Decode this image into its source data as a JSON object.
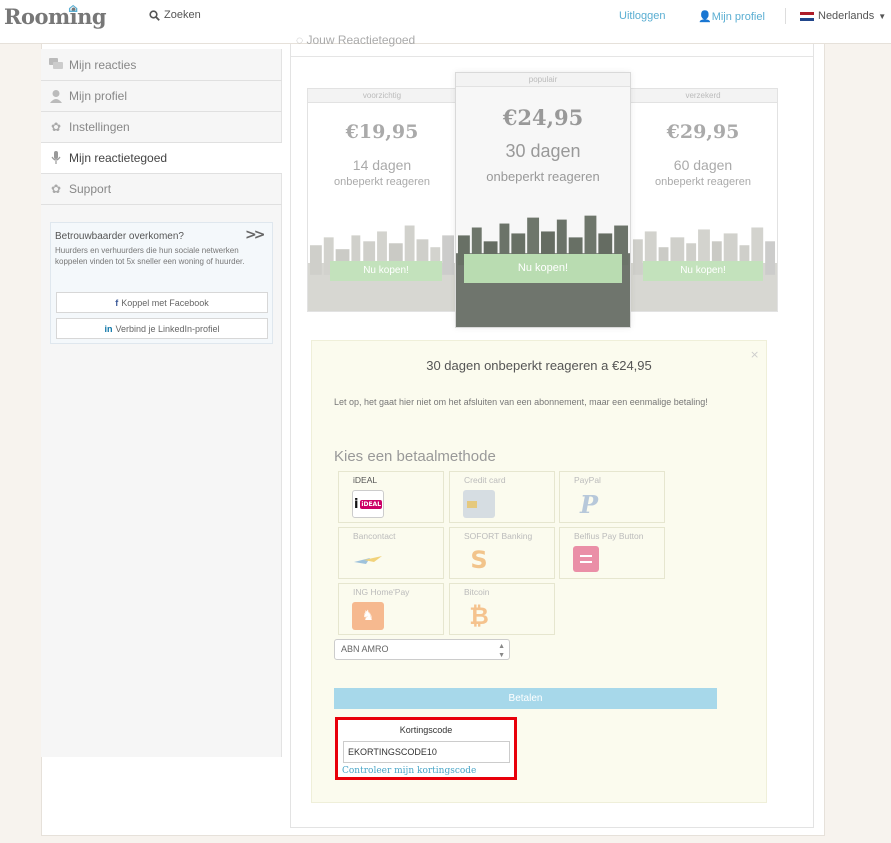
{
  "header": {
    "logo": "Rooming",
    "search_label": "Zoeken",
    "logout_label": "Uitloggen",
    "profile_label": "Mijn profiel",
    "language_label": "Nederlands"
  },
  "sidebar": {
    "items": [
      {
        "label": "Mijn reacties",
        "icon": "chat-icon"
      },
      {
        "label": "Mijn profiel",
        "icon": "user-icon"
      },
      {
        "label": "Instellingen",
        "icon": "gear-icon"
      },
      {
        "label": "Mijn reactietegoed",
        "icon": "microphone-icon",
        "active": true
      },
      {
        "label": "Support",
        "icon": "gear-icon"
      }
    ],
    "promo": {
      "title": "Betrouwbaarder overkomen?",
      "text": "Huurders en verhuurders die hun sociale netwerken koppelen vinden tot 5x sneller een woning of huurder.",
      "facebook_label": "Koppel met Facebook",
      "linkedin_label": "Verbind je LinkedIn-profiel"
    }
  },
  "main": {
    "heading": "Jouw Reactietegoed",
    "plans": [
      {
        "tag": "voorzichtig",
        "price": "€19,95",
        "days": "14 dagen",
        "sub": "onbeperkt reageren",
        "button": "Nu kopen!"
      },
      {
        "tag": "populair",
        "price": "€24,95",
        "days": "30 dagen",
        "sub": "onbeperkt reageren",
        "button": "Nu kopen!"
      },
      {
        "tag": "verzekerd",
        "price": "€29,95",
        "days": "60 dagen",
        "sub": "onbeperkt reageren",
        "button": "Nu kopen!"
      }
    ],
    "payment": {
      "title": "30 dagen onbeperkt reageren a €24,95",
      "close": "×",
      "note": "Let op, het gaat hier niet om het afsluiten van een abonnement, maar een eenmalige betaling!",
      "choose_heading": "Kies een betaalmethode",
      "methods": [
        {
          "label": "iDEAL",
          "icon": "ideal-icon",
          "selected": true
        },
        {
          "label": "Credit card",
          "icon": "credit-card-icon"
        },
        {
          "label": "PayPal",
          "icon": "paypal-icon"
        },
        {
          "label": "Bancontact",
          "icon": "bancontact-icon"
        },
        {
          "label": "SOFORT Banking",
          "icon": "sofort-icon"
        },
        {
          "label": "Belfius Pay Button",
          "icon": "belfius-icon"
        },
        {
          "label": "ING Home'Pay",
          "icon": "ing-icon"
        },
        {
          "label": "Bitcoin",
          "icon": "bitcoin-icon"
        }
      ],
      "bank_selected": "ABN AMRO",
      "pay_button": "Betalen",
      "coupon": {
        "label": "Kortingscode",
        "value": "EKORTINGSCODE10",
        "check_link": "Controleer mijn kortingscode"
      }
    }
  },
  "colors": {
    "accent": "#5aaed2",
    "buy_button": "#c3e2bc",
    "pay_button": "#a7d8ea",
    "highlight": "#e8000a"
  }
}
